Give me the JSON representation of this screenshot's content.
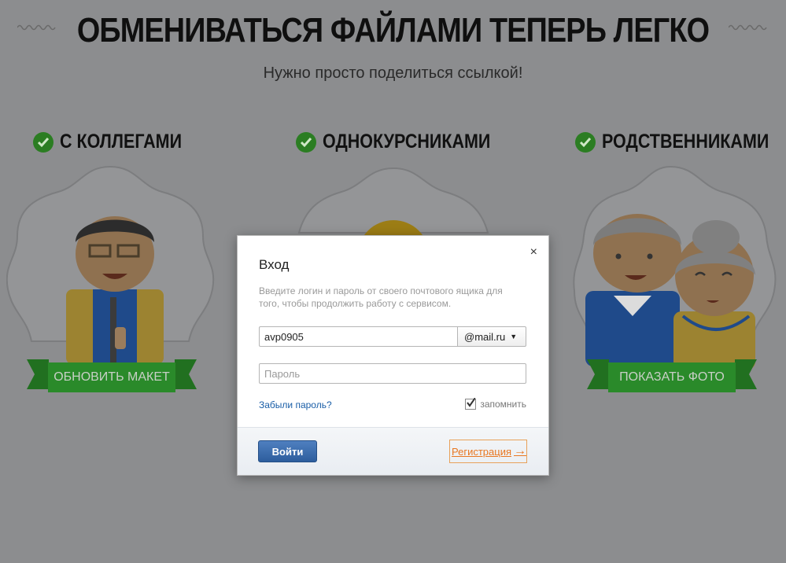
{
  "hero": {
    "title": "ОБМЕНИВАТЬСЯ ФАЙЛАМИ ТЕПЕРЬ ЛЕГКО",
    "subtitle": "Нужно просто поделиться ссылкой!"
  },
  "categories": [
    {
      "label": "С КОЛЛЕГАМИ",
      "button": "ОБНОВИТЬ МАКЕТ"
    },
    {
      "label": "ОДНОКУРСНИКАМИ"
    },
    {
      "label": "РОДСТВЕННИКАМИ",
      "button": "ПОКАЗАТЬ ФОТО"
    }
  ],
  "modal": {
    "title": "Вход",
    "close": "×",
    "description": "Введите логин и пароль от своего почтового ящика для того, чтобы продолжить работу с сервисом.",
    "login_value": "avp0905",
    "domain": "@mail.ru",
    "password_placeholder": "Пароль",
    "forgot": "Забыли пароль?",
    "remember": "запомнить",
    "remember_checked": true,
    "submit": "Войти",
    "register": "Регистрация",
    "register_arrow": "→"
  },
  "colors": {
    "overlay_bg": "#8c8d8f",
    "ribbon_green": "#2a8a2a",
    "check_green": "#2b7d22",
    "link_blue": "#1a5ea7",
    "register_orange": "#e87722",
    "button_blue": "#2d5d9d"
  }
}
